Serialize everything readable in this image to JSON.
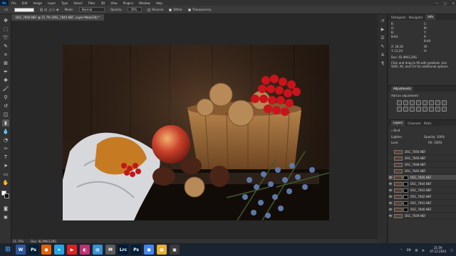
{
  "menubar": {
    "logo": "Ps",
    "items": [
      "File",
      "Edit",
      "Image",
      "Layer",
      "Type",
      "Select",
      "Filter",
      "3D",
      "View",
      "Plugins",
      "Window",
      "Help"
    ],
    "win_controls": [
      "—",
      "▢",
      "✕"
    ]
  },
  "options": {
    "mode_label": "Mode:",
    "mode_value": "Normal",
    "opacity_label": "Opacity:",
    "opacity_value": "35%",
    "reverse_label": "Reverse",
    "dither_label": "Dither",
    "transparency_label": "Transparency"
  },
  "document": {
    "tab_title": "DSC_7856.NEF @ 21.7% (DSC_7845.NEF, Layer Mask/16) *",
    "zoom": "21.75%",
    "doc_size": "Doc: 92,9M/3,29G"
  },
  "right_panel": {
    "top_tabs": [
      "Histogram",
      "Navigator",
      "Info"
    ],
    "info_rows": [
      "R:",
      "G:",
      "B:",
      "8-bit",
      "C:",
      "M:",
      "Y:",
      "K:",
      "8-bit",
      "X:",
      "Y:",
      "W:",
      "H:"
    ],
    "info_x": "X:  18,18",
    "info_y": "Y:  12,24",
    "doc_size": "Doc: 92,9M/3,29G",
    "hint": "Click and drag to fill with gradient. Use Shift, Alt, and Ctrl for additional options.",
    "adjustments_title": "Adjustments",
    "adjustments_subtitle": "Add an adjustment",
    "layers_tabs": [
      "Layers",
      "Channels",
      "Paths"
    ],
    "kind_label": "Kind",
    "blend_mode": "Lighten",
    "opacity_label": "Opacity:",
    "opacity_value": "100%",
    "lock_label": "Lock:",
    "fill_label": "Fill:",
    "fill_value": "100%",
    "layers": [
      {
        "name": "DSC_7856.NEF",
        "visible": false,
        "mask": false,
        "selected": false
      },
      {
        "name": "DSC_7856.NEF",
        "visible": false,
        "mask": false,
        "selected": false
      },
      {
        "name": "DSC_7848.NEF",
        "visible": false,
        "mask": false,
        "selected": false
      },
      {
        "name": "DSC_7845.NEF",
        "visible": false,
        "mask": false,
        "selected": false
      },
      {
        "name": "DSC_7845.NEF",
        "visible": true,
        "mask": true,
        "selected": true
      },
      {
        "name": "DSC_7844.NEF",
        "visible": true,
        "mask": true,
        "selected": false
      },
      {
        "name": "DSC_7843.NEF",
        "visible": true,
        "mask": true,
        "selected": false
      },
      {
        "name": "DSC_7842.NEF",
        "visible": true,
        "mask": true,
        "selected": false
      },
      {
        "name": "DSC_7841.NEF",
        "visible": true,
        "mask": true,
        "selected": false
      },
      {
        "name": "DSC_7840.NEF",
        "visible": true,
        "mask": true,
        "selected": false
      },
      {
        "name": "DSC_7839.NEF",
        "visible": true,
        "mask": false,
        "selected": false
      }
    ]
  },
  "taskbar": {
    "apps": [
      {
        "label": "W",
        "color": "#2b579a"
      },
      {
        "label": "Ps",
        "color": "#001e36"
      },
      {
        "label": "●",
        "color": "#e66000"
      },
      {
        "label": "➤",
        "color": "#2aa3e0"
      },
      {
        "label": "▶",
        "color": "#e02020"
      },
      {
        "label": "◐",
        "color": "#c03070"
      },
      {
        "label": "▤",
        "color": "#3a8fd0"
      },
      {
        "label": "M",
        "color": "#5a5a5a"
      },
      {
        "label": "Lrc",
        "color": "#001a33"
      },
      {
        "label": "Ps",
        "color": "#001e36"
      },
      {
        "label": "●",
        "color": "#4285f4"
      },
      {
        "label": "▦",
        "color": "#e8b030"
      },
      {
        "label": "▣",
        "color": "#3a3a3a"
      }
    ],
    "lang": "EN",
    "time": "21:59",
    "date": "07.12.2023"
  },
  "colors": {
    "accent": "#31a8ff",
    "panel_bg": "#323232",
    "canvas_bg": "#282828"
  }
}
